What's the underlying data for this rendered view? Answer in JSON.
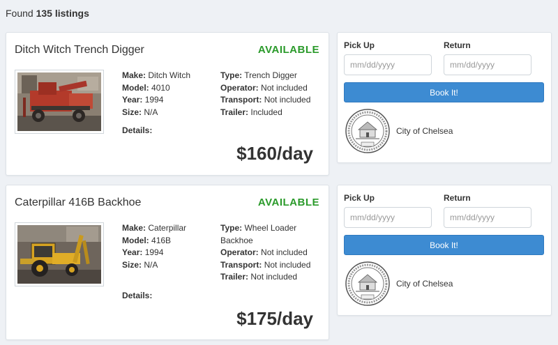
{
  "results": {
    "prefix": "Found",
    "count": "135 listings"
  },
  "listings": [
    {
      "title": "Ditch Witch Trench Digger",
      "status": "AVAILABLE",
      "image_icon": "trencher-photo-icon",
      "specs_left": [
        {
          "label": "Make:",
          "value": "Ditch Witch"
        },
        {
          "label": "Model:",
          "value": "4010"
        },
        {
          "label": "Year:",
          "value": "1994"
        },
        {
          "label": "Size:",
          "value": "N/A"
        }
      ],
      "specs_right": [
        {
          "label": "Type:",
          "value": "Trench Digger"
        },
        {
          "label": "Operator:",
          "value": "Not included"
        },
        {
          "label": "Transport:",
          "value": "Not included"
        },
        {
          "label": "Trailer:",
          "value": "Included"
        }
      ],
      "details_label": "Details:",
      "price": "$160/day",
      "booking": {
        "pickup_label": "Pick Up",
        "return_label": "Return",
        "pickup_placeholder": "mm/dd/yyyy",
        "return_placeholder": "mm/dd/yyyy",
        "button": "Book It!",
        "owner": "City of Chelsea",
        "seal_icon": "city-seal-icon"
      }
    },
    {
      "title": "Caterpillar 416B Backhoe",
      "status": "AVAILABLE",
      "image_icon": "backhoe-photo-icon",
      "specs_left": [
        {
          "label": "Make:",
          "value": "Caterpillar"
        },
        {
          "label": "Model:",
          "value": "416B"
        },
        {
          "label": "Year:",
          "value": "1994"
        },
        {
          "label": "Size:",
          "value": "N/A"
        }
      ],
      "specs_right": [
        {
          "label": "Type:",
          "value": "Wheel Loader"
        },
        {
          "label": "",
          "value": "Backhoe"
        },
        {
          "label": "Operator:",
          "value": "Not included"
        },
        {
          "label": "Transport:",
          "value": "Not included"
        },
        {
          "label": "Trailer:",
          "value": "Not included"
        }
      ],
      "details_label": "Details:",
      "price": "$175/day",
      "booking": {
        "pickup_label": "Pick Up",
        "return_label": "Return",
        "pickup_placeholder": "mm/dd/yyyy",
        "return_placeholder": "mm/dd/yyyy",
        "button": "Book It!",
        "owner": "City of Chelsea",
        "seal_icon": "city-seal-icon"
      }
    }
  ],
  "colors": {
    "available": "#2a9a2a",
    "button": "#3d8bd2",
    "background": "#eef1f5"
  }
}
